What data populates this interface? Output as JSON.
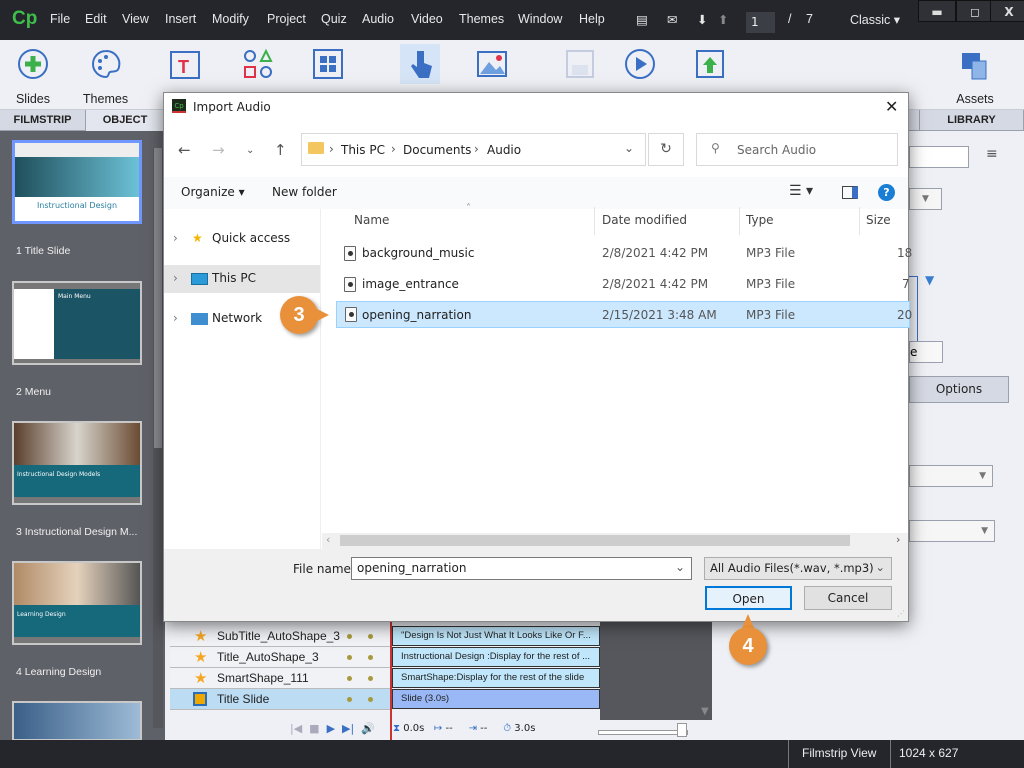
{
  "app": {
    "logo": "Cp",
    "menu": [
      "File",
      "Edit",
      "View",
      "Insert",
      "Modify",
      "Project",
      "Quiz",
      "Audio",
      "Video",
      "Themes",
      "Window",
      "Help"
    ],
    "page_current": "1",
    "page_sep": "/",
    "page_total": "7",
    "workspace": "Classic",
    "win": {
      "min": "▬",
      "max": "◻",
      "close": "X"
    }
  },
  "toolbar": {
    "slides": "Slides",
    "themes": "Themes",
    "assets": "Assets"
  },
  "panels": {
    "filmstrip": "FILMSTRIP",
    "object_state": "OBJECT STATE",
    "library": "LIBRARY",
    "options": "Options",
    "partial_btn": "e"
  },
  "filmstrip": [
    {
      "label": "1 Title Slide",
      "thumb_title": "Instructional Design"
    },
    {
      "label": "2 Menu",
      "thumb_title": "Main Menu"
    },
    {
      "label": "3 Instructional Design M...",
      "thumb_title": "Instructional Design Models"
    },
    {
      "label": "4 Learning Design",
      "thumb_title": "Learning Design"
    }
  ],
  "timeline": {
    "rows": [
      {
        "name": "SubTitle_AutoShape_3",
        "bar": "\"Design Is Not Just What It Looks Like Or F..."
      },
      {
        "name": "Title_AutoShape_3",
        "bar": "Instructional Design :Display for the rest of ..."
      },
      {
        "name": "SmartShape_111",
        "bar": "SmartShape:Display for the rest of the slide"
      },
      {
        "name": "Title Slide",
        "bar": "Slide (3.0s)"
      }
    ],
    "time_start": "0.0s",
    "time_in": "--",
    "time_out": "--",
    "duration": "3.0s"
  },
  "status": {
    "view": "Filmstrip View",
    "size": "1024 x 627"
  },
  "dialog": {
    "title": "Import Audio",
    "breadcrumb": [
      "This PC",
      "Documents",
      "Audio"
    ],
    "search_placeholder": "Search Audio",
    "organize": "Organize",
    "new_folder": "New folder",
    "nav": [
      "Quick access",
      "This PC",
      "Network"
    ],
    "columns": [
      "Name",
      "Date modified",
      "Type",
      "Size"
    ],
    "files": [
      {
        "name": "background_music",
        "date": "2/8/2021 4:42 PM",
        "type": "MP3 File",
        "size": "18"
      },
      {
        "name": "image_entrance",
        "date": "2/8/2021 4:42 PM",
        "type": "MP3 File",
        "size": "7"
      },
      {
        "name": "opening_narration",
        "date": "2/15/2021 3:48 AM",
        "type": "MP3 File",
        "size": "20"
      }
    ],
    "file_name_label": "File name:",
    "file_name_value": "opening_narration",
    "filter": "All Audio Files(*.wav, *.mp3)",
    "open": "Open",
    "cancel": "Cancel"
  },
  "callouts": {
    "step3": "3",
    "step4": "4"
  },
  "colors": {
    "accent": "#e8913a",
    "selection": "#cce8ff"
  }
}
